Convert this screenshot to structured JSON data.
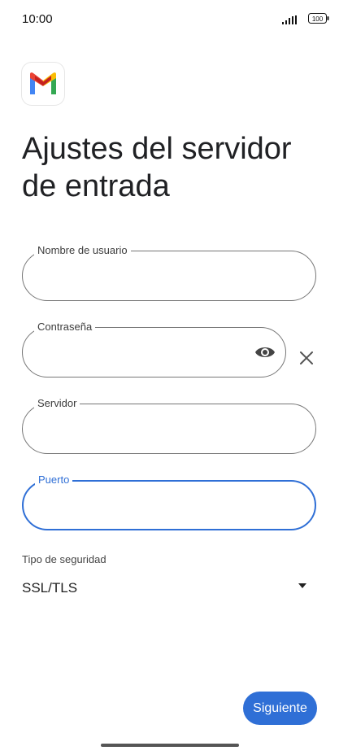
{
  "status_bar": {
    "time": "10:00",
    "battery": "100"
  },
  "app": {
    "logo": "gmail-logo-icon"
  },
  "page": {
    "title": "Ajustes del servidor de entrada"
  },
  "form": {
    "username": {
      "label": "Nombre de usuario",
      "value": ""
    },
    "password": {
      "label": "Contraseña",
      "value": ""
    },
    "server": {
      "label": "Servidor",
      "value": ""
    },
    "port": {
      "label": "Puerto",
      "value": ""
    },
    "security": {
      "label": "Tipo de seguridad",
      "value": "SSL/TLS"
    }
  },
  "actions": {
    "next_label": "Siguiente"
  },
  "colors": {
    "accent": "#2f6fd6"
  }
}
